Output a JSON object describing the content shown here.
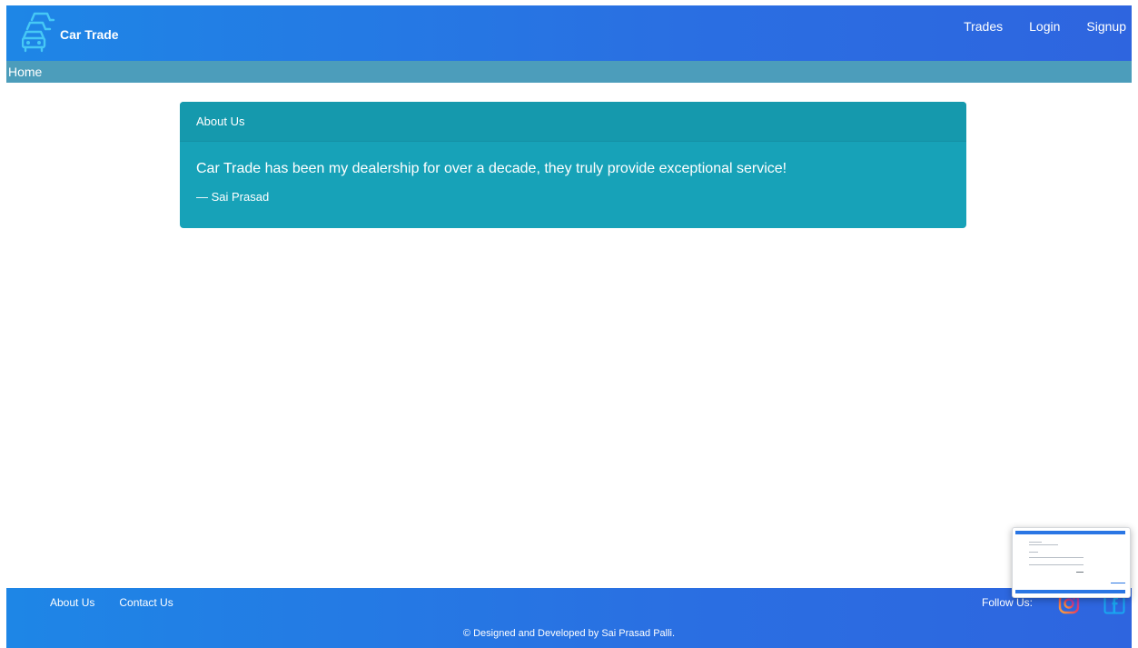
{
  "navbar": {
    "brand": {
      "name": "Car Trade",
      "logo_icon": "car-stack-icon"
    },
    "links": [
      {
        "label": "Trades"
      },
      {
        "label": "Login"
      },
      {
        "label": "Signup"
      }
    ]
  },
  "breadcrumb": {
    "label": "Home"
  },
  "card": {
    "header": "About Us",
    "quote": "Car Trade has been my dealership for over a decade, they truly provide exceptional service!",
    "author": "— Sai Prasad"
  },
  "footer": {
    "links": [
      {
        "label": "About Us"
      },
      {
        "label": "Contact Us"
      }
    ],
    "follow_label": "Follow Us:",
    "social_icons": [
      "instagram-icon",
      "facebook-icon"
    ],
    "copyright": "© Designed and Developed by Sai Prasad Palli."
  },
  "colors": {
    "nav_gradient_start": "#1e86e6",
    "nav_gradient_end": "#2e65df",
    "breadcrumb_bg": "#4c9dbb",
    "card_bg": "#17a2b8",
    "logo": "#46c8f5"
  }
}
